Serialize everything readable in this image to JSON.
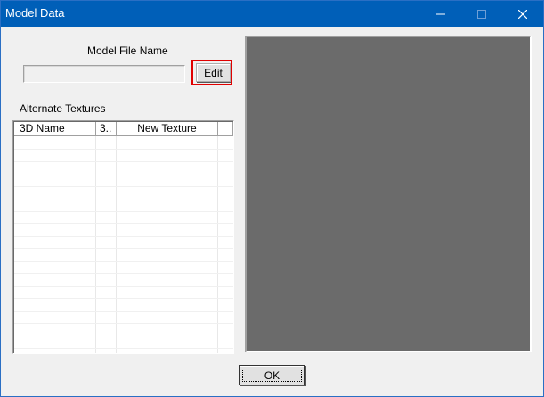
{
  "window": {
    "title": "Model Data",
    "title_bar_color": "#005fb8",
    "controls": {
      "minimize": "minimize-icon",
      "maximize": "maximize-icon",
      "close": "close-icon"
    }
  },
  "model_file": {
    "label": "Model File Name",
    "value": "",
    "edit_label": "Edit"
  },
  "alternate_textures": {
    "label": "Alternate Textures",
    "columns": [
      "3D Name",
      "3..",
      "New Texture",
      ""
    ],
    "rows": []
  },
  "footer": {
    "ok_label": "OK"
  },
  "colors": {
    "preview_background": "#6b6b6b",
    "highlight": "#e00000"
  }
}
